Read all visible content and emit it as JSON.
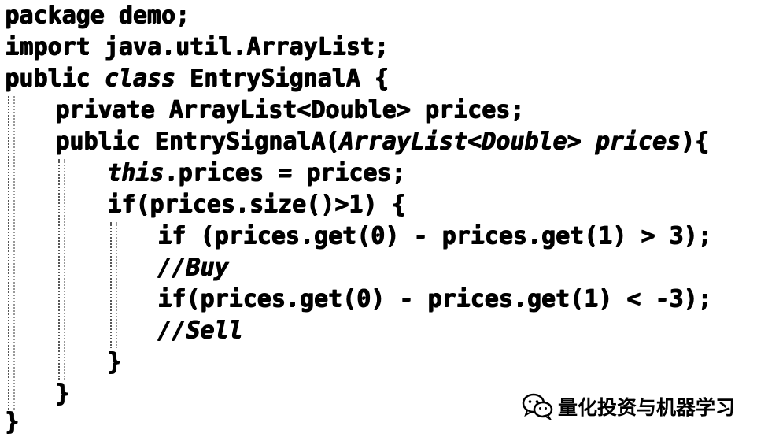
{
  "code": {
    "lines": [
      "package demo;",
      "import java.util.ArrayList;",
      "public ",
      "class",
      " EntrySignalA {",
      "private ArrayList<Double> prices;",
      "public EntrySignalA(",
      "ArrayList<Double> prices",
      "){",
      "this",
      ".prices = prices;",
      "if(prices.size()>1) {",
      "if (prices.get(0) - prices.get(1) > 3);",
      "//Buy",
      "if(prices.get(0) - prices.get(1) < -3);",
      "//Sell",
      "}",
      "}",
      "}"
    ]
  },
  "watermark": {
    "text": "量化投资与机器学习",
    "icon": "wechat-icon"
  }
}
